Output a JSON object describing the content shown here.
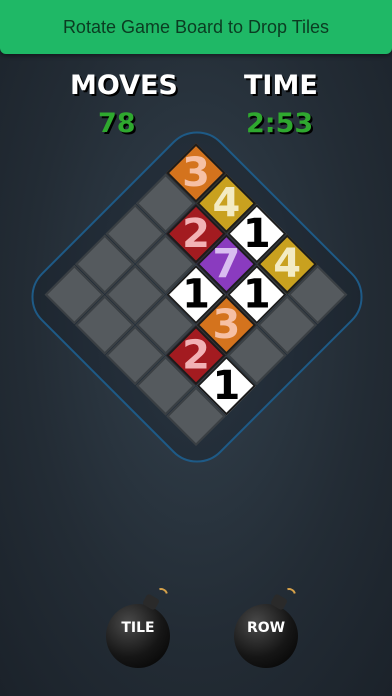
{
  "banner": {
    "text": "Rotate Game Board to Drop Tiles"
  },
  "stats": {
    "moves_label": "MOVES",
    "moves_value": "78",
    "time_label": "TIME",
    "time_value": "2:53"
  },
  "board": {
    "tiles": [
      {
        "row": 0,
        "col": 0,
        "value": "3",
        "bg": "#d4731d",
        "fg": "#f6c0a4"
      },
      {
        "row": 0,
        "col": 1,
        "value": "4",
        "bg": "#c9a11f",
        "fg": "#f3ebc3"
      },
      {
        "row": 0,
        "col": 2,
        "value": "1",
        "bg": "#ffffff",
        "fg": "#000000"
      },
      {
        "row": 0,
        "col": 3,
        "value": "4",
        "bg": "#c9a11f",
        "fg": "#f3ebc3"
      },
      {
        "row": 1,
        "col": 1,
        "value": "2",
        "bg": "#a31b20",
        "fg": "#f2b2b5"
      },
      {
        "row": 1,
        "col": 2,
        "value": "7",
        "bg": "#8a3bbf",
        "fg": "#d9bdf0"
      },
      {
        "row": 1,
        "col": 3,
        "value": "1",
        "bg": "#ffffff",
        "fg": "#000000"
      },
      {
        "row": 2,
        "col": 2,
        "value": "1",
        "bg": "#ffffff",
        "fg": "#000000"
      },
      {
        "row": 2,
        "col": 3,
        "value": "3",
        "bg": "#d4731d",
        "fg": "#f6c0a4"
      },
      {
        "row": 3,
        "col": 3,
        "value": "2",
        "bg": "#a31b20",
        "fg": "#f2b2b5"
      },
      {
        "row": 3,
        "col": 4,
        "value": "1",
        "bg": "#ffffff",
        "fg": "#000000"
      }
    ]
  },
  "buttons": {
    "tile_label": "TILE",
    "row_label": "ROW"
  }
}
